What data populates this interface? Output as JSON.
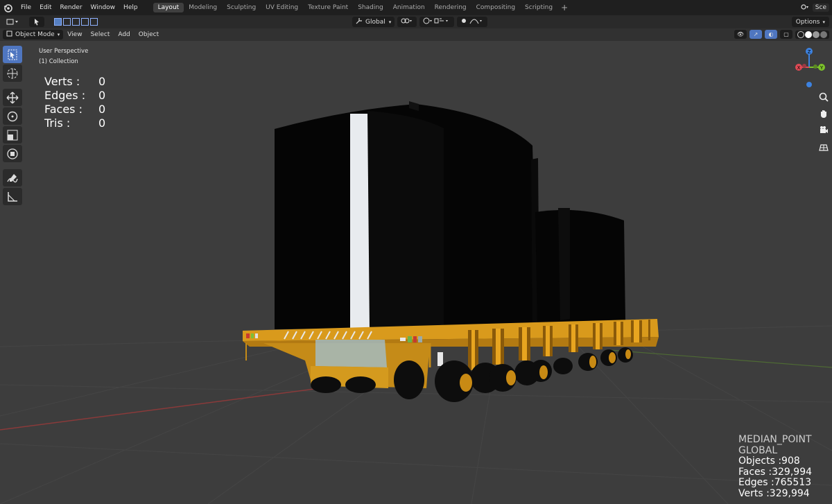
{
  "menu": [
    "File",
    "Edit",
    "Render",
    "Window",
    "Help"
  ],
  "workspaces": [
    {
      "label": "Layout",
      "active": true
    },
    {
      "label": "Modeling"
    },
    {
      "label": "Sculpting"
    },
    {
      "label": "UV Editing"
    },
    {
      "label": "Texture Paint"
    },
    {
      "label": "Shading"
    },
    {
      "label": "Animation"
    },
    {
      "label": "Rendering"
    },
    {
      "label": "Compositing"
    },
    {
      "label": "Scripting"
    }
  ],
  "workspace_add": "+",
  "scene_label": "Sce",
  "tool_header": {
    "orientation": "Global",
    "options": "Options"
  },
  "viewport_header": {
    "mode": "Object Mode",
    "menus": [
      "View",
      "Select",
      "Add",
      "Object"
    ]
  },
  "view_info": {
    "perspective": "User Perspective",
    "collection": "(1) Collection"
  },
  "stats": [
    {
      "label": "Verts :",
      "value": "0"
    },
    {
      "label": "Edges :",
      "value": "0"
    },
    {
      "label": "Faces :",
      "value": "0"
    },
    {
      "label": "Tris :",
      "value": "0"
    }
  ],
  "bottom_stats": {
    "pivot": "MEDIAN_POINT",
    "orientation": "GLOBAL",
    "objects": "Objects :908",
    "faces": "Faces :329,994",
    "edges": "Edges :765513",
    "verts": "Verts :329,994"
  },
  "gizmo": {
    "x_label": "X",
    "y_label": "Y",
    "z_label": "Z"
  },
  "colors": {
    "accent_blue": "#4f76c0",
    "truck_orange": "#d99a1c",
    "viewport_bg": "#3d3d3d",
    "axis_x": "#e04a55",
    "axis_y": "#7cc22b",
    "axis_z": "#3d82e0"
  },
  "icons": {
    "blender_logo": "blender-logo-icon",
    "select_box": "cursor-select-icon",
    "cursor": "3d-cursor-icon",
    "move": "move-icon",
    "rotate": "rotate-icon",
    "scale": "scale-icon",
    "transform": "transform-icon",
    "annotate": "annotate-icon",
    "measure": "measure-icon",
    "zoom": "zoom-icon",
    "pan": "hand-icon",
    "camera": "camera-icon",
    "grid": "ortho-grid-icon"
  }
}
